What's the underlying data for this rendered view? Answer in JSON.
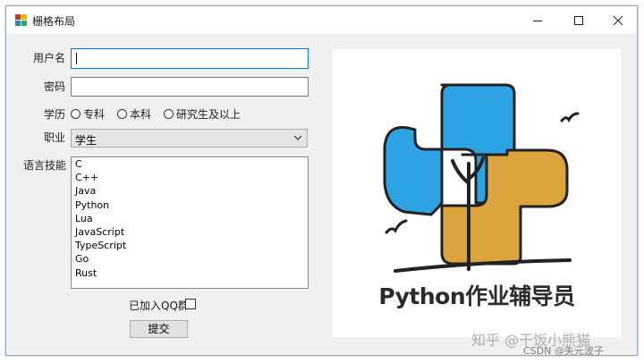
{
  "window": {
    "title": "栅格布局",
    "controls": {
      "minimize": "minimize-icon",
      "maximize": "maximize-icon",
      "close": "close-icon"
    }
  },
  "form": {
    "username_label": "用户名",
    "username_value": "",
    "password_label": "密码",
    "password_value": "",
    "education_label": "学历",
    "education_options": [
      "专科",
      "本科",
      "研究生及以上"
    ],
    "job_label": "职业",
    "job_selected": "学生",
    "skills_label": "语言技能",
    "skills": [
      "C",
      "C++",
      "Java",
      "Python",
      "Lua",
      "JavaScript",
      "TypeScript",
      "Go",
      "Rust"
    ],
    "qq_label": "已加入QQ群",
    "qq_checked": false,
    "submit_label": "提交"
  },
  "image_panel": {
    "caption": "Python作业辅导员",
    "colors": {
      "blue": "#2ea3e3",
      "yellow": "#dba43c",
      "outline": "#222222"
    }
  },
  "watermark": {
    "line1": "知乎 @干饭小熊猫",
    "line2": "CSDN @失元波子"
  }
}
